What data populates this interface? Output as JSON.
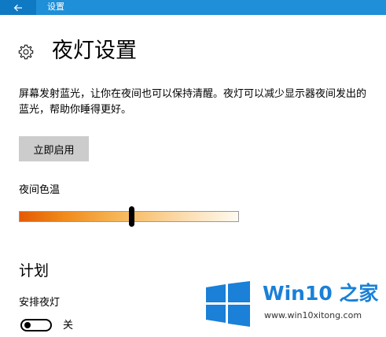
{
  "titlebar": {
    "title": "设置",
    "back_icon": "arrow-left-icon",
    "background": "#1e8fd8",
    "back_background": "#0f79c3"
  },
  "header": {
    "icon": "gear-icon",
    "title": "夜灯设置"
  },
  "description": "屏幕发射蓝光，让你在夜间也可以保持清醒。夜灯可以减少显示器夜间发出的蓝光，帮助你睡得更好。",
  "enable_button": {
    "label": "立即启用"
  },
  "color_temperature": {
    "label": "夜间色温",
    "value": 0.51,
    "gradient_colors": [
      "#e45a05",
      "#f08a1a",
      "#f6b657",
      "#fbdcae",
      "#fffaf0"
    ]
  },
  "schedule": {
    "section_title": "计划",
    "toggle_label": "安排夜灯",
    "toggle_on": false,
    "toggle_state_text": "关"
  },
  "watermark": {
    "logo_icon": "windows-logo-icon",
    "title": "Win10 之家",
    "url": "www.win10xitong.com",
    "color": "#1a80d8"
  }
}
